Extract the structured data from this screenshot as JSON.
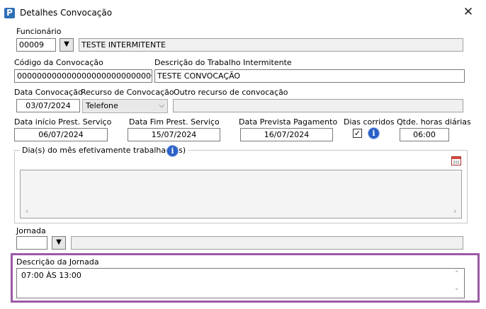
{
  "window": {
    "title": "Detalhes Convocação",
    "close_glyph": "✕"
  },
  "funcionario": {
    "label": "Funcionário",
    "code": "00009",
    "name": "TESTE INTERMITENTE"
  },
  "codigo": {
    "label": "Código da Convocação",
    "value": "00000000000000000000000000002"
  },
  "descricao_trabalho": {
    "label": "Descrição do Trabalho Intermitente",
    "value": "TESTE CONVOCAÇÃO"
  },
  "data_convocacao": {
    "label": "Data Convocação",
    "value": "03/07/2024"
  },
  "recurso": {
    "label": "Recurso de Convocação",
    "value": "Telefone"
  },
  "outro_recurso": {
    "label": "Outro recurso de convocação",
    "value": ""
  },
  "inicio": {
    "label": "Data início Prest. Serviço",
    "value": "06/07/2024"
  },
  "fim": {
    "label": "Data Fim Prest. Serviço",
    "value": "15/07/2024"
  },
  "pagamento": {
    "label": "Data Prevista Pagamento",
    "value": "16/07/2024"
  },
  "dias_corridos": {
    "label": "Dias corridos",
    "checked": true,
    "check_glyph": "✓"
  },
  "horas": {
    "label": "Qtde. horas diárias",
    "value": "06:00"
  },
  "dias_mes": {
    "label": "Dia(s) do mês efetivamente trabalhado(s)"
  },
  "jornada": {
    "label": "Jornada",
    "code": "",
    "name": ""
  },
  "descricao_jornada": {
    "label": "Descrição da Jornada",
    "value": "07:00 ÀS 13:00"
  },
  "icons": {
    "info": "i",
    "app": "P",
    "dropdown": "▼",
    "chevron": "⌵",
    "left": "‹",
    "right": "›",
    "up": "˄",
    "down": "˅"
  },
  "colors": {
    "highlight": "#9b59a6",
    "info": "#2a61c8"
  }
}
